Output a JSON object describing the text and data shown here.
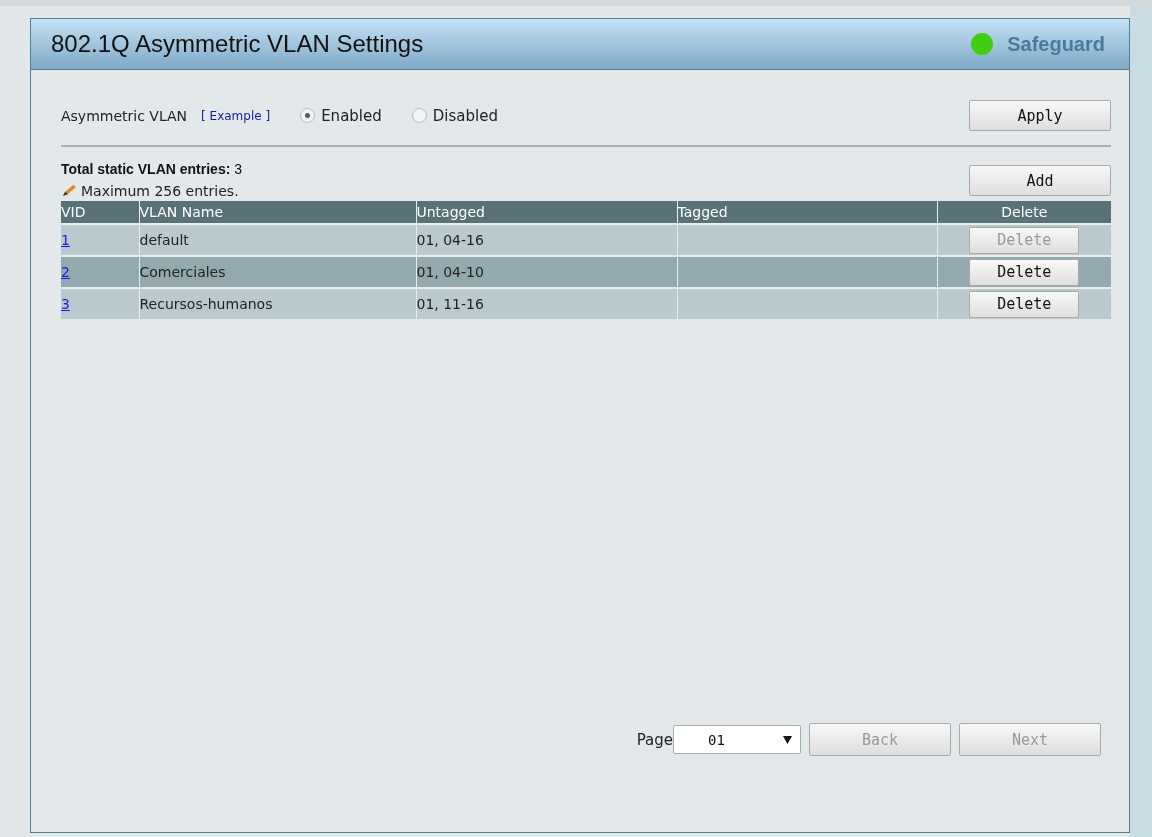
{
  "panel": {
    "title": "802.1Q Asymmetric VLAN Settings",
    "status": {
      "label": "Safeguard",
      "color": "#44cc11"
    }
  },
  "asymmetric_vlan": {
    "label": "Asymmetric VLAN",
    "link": "[ Example ]",
    "options": [
      {
        "label": "Enabled",
        "selected": true
      },
      {
        "label": "Disabled",
        "selected": false
      }
    ],
    "apply": "Apply"
  },
  "summary": {
    "total_label": "Total static VLAN entries:",
    "total": "3",
    "note": "Maximum 256 entries.",
    "add": "Add"
  },
  "table": {
    "columns": [
      "VID",
      "VLAN Name",
      "Untagged",
      "Tagged",
      "Delete"
    ],
    "rows": [
      {
        "vid": "1",
        "name": "default",
        "untagged": "01, 04-16",
        "tagged": "",
        "delete": {
          "label": "Delete",
          "disabled": true
        }
      },
      {
        "vid": "2",
        "name": "Comerciales",
        "untagged": "01, 04-10",
        "tagged": "",
        "delete": {
          "label": "Delete",
          "disabled": false
        }
      },
      {
        "vid": "3",
        "name": "Recursos-humanos",
        "untagged": "01, 11-16",
        "tagged": "",
        "delete": {
          "label": "Delete",
          "disabled": false
        }
      }
    ]
  },
  "pagination": {
    "label": "Page",
    "page": "01",
    "back": {
      "label": "Back",
      "disabled": true
    },
    "next": {
      "label": "Next",
      "disabled": true
    }
  }
}
